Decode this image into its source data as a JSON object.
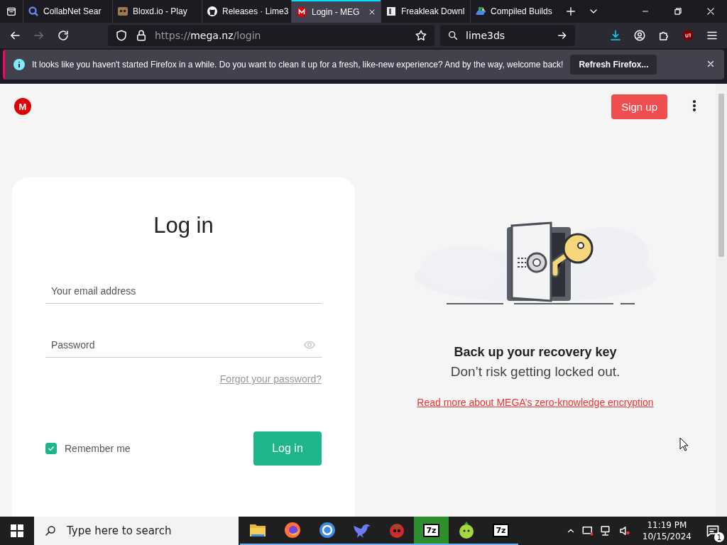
{
  "tabs": [
    {
      "title": "CollabNet Sear",
      "selected": false
    },
    {
      "title": "Bloxd.io - Play",
      "selected": false
    },
    {
      "title": "Releases · Lime3",
      "selected": false
    },
    {
      "title": "Login - MEG",
      "selected": true
    },
    {
      "title": "Freakleak Downl",
      "selected": false
    },
    {
      "title": "Compiled Builds",
      "selected": false
    }
  ],
  "toolbar": {
    "url": {
      "scheme": "https://",
      "host": "mega.nz",
      "path": "/login"
    },
    "search": "lime3ds",
    "forward_disabled": true
  },
  "notification": {
    "message": "It looks like you haven't started Firefox in a while. Do you want to clean it up for a fresh, like-new experience? And by the way, welcome back!",
    "button": "Refresh Firefox..."
  },
  "page": {
    "logo": "M",
    "signup": "Sign up",
    "login": {
      "title": "Log in",
      "email_placeholder": "Your email address",
      "password_placeholder": "Password",
      "forgot": "Forgot your password?",
      "remember": {
        "label": "Remember me",
        "checked": true
      },
      "button": "Log in"
    },
    "promo": {
      "heading": "Back up your recovery key",
      "subheading": "Don’t risk getting locked out.",
      "link": "Read more about MEGA’s zero-knowledge encryption"
    }
  },
  "taskbar": {
    "search_placeholder": "Type here to search",
    "apps": [
      {
        "kind": "folder",
        "selected": false
      },
      {
        "kind": "firefox",
        "selected": false
      },
      {
        "kind": "circle",
        "selected": false
      },
      {
        "kind": "bird",
        "selected": false
      },
      {
        "kind": "tomato",
        "selected": false
      },
      {
        "kind": "archive",
        "label": "7z",
        "selected": true
      },
      {
        "kind": "lime",
        "selected": false
      },
      {
        "kind": "archive",
        "label": "7z",
        "selected": false
      }
    ],
    "time": "11:19 PM",
    "date": "10/15/2024",
    "notifications": "1"
  }
}
